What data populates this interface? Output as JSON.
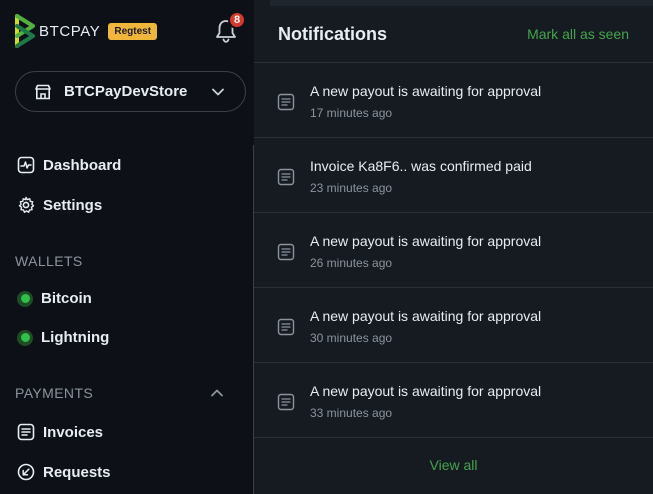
{
  "brand": {
    "name": "BTCPAY",
    "badge": "Regtest"
  },
  "notifications_count": "8",
  "store": {
    "name": "BTCPayDevStore"
  },
  "nav": {
    "dashboard": "Dashboard",
    "settings": "Settings",
    "wallets_section": "WALLETS",
    "bitcoin": "Bitcoin",
    "lightning": "Lightning",
    "payments_section": "PAYMENTS",
    "invoices": "Invoices",
    "requests": "Requests"
  },
  "panel": {
    "title": "Notifications",
    "mark_all": "Mark all as seen",
    "view_all": "View all",
    "items": [
      {
        "text": "A new payout is awaiting for approval",
        "time": "17 minutes ago"
      },
      {
        "text": "Invoice Ka8F6.. was confirmed paid",
        "time": "23 minutes ago"
      },
      {
        "text": "A new payout is awaiting for approval",
        "time": "26 minutes ago"
      },
      {
        "text": "A new payout is awaiting for approval",
        "time": "30 minutes ago"
      },
      {
        "text": "A new payout is awaiting for approval",
        "time": "33 minutes ago"
      }
    ]
  },
  "colors": {
    "accent": "#44a44d",
    "badge": "#f0b63c",
    "alert": "#d6392c"
  }
}
